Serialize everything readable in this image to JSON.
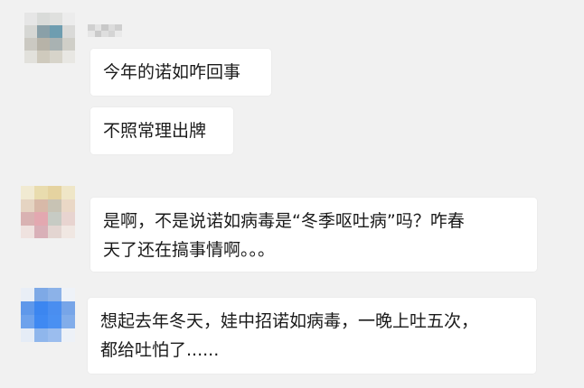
{
  "messages": [
    {
      "text": "今年的诺如咋回事"
    },
    {
      "text": "不照常理出牌"
    },
    {
      "lines": [
        "是啊，不是说诺如病毒是“冬季呕吐病”吗？咋春",
        "天了还在搞事情啊。。。"
      ]
    },
    {
      "lines": [
        "想起去年冬天，娃中招诺如病毒，一晚上吐五次，",
        "都给吐怕了......"
      ]
    }
  ],
  "colors": {
    "background": "#f1f1f1",
    "bubble": "#ffffff",
    "text": "#1a1a1a"
  }
}
